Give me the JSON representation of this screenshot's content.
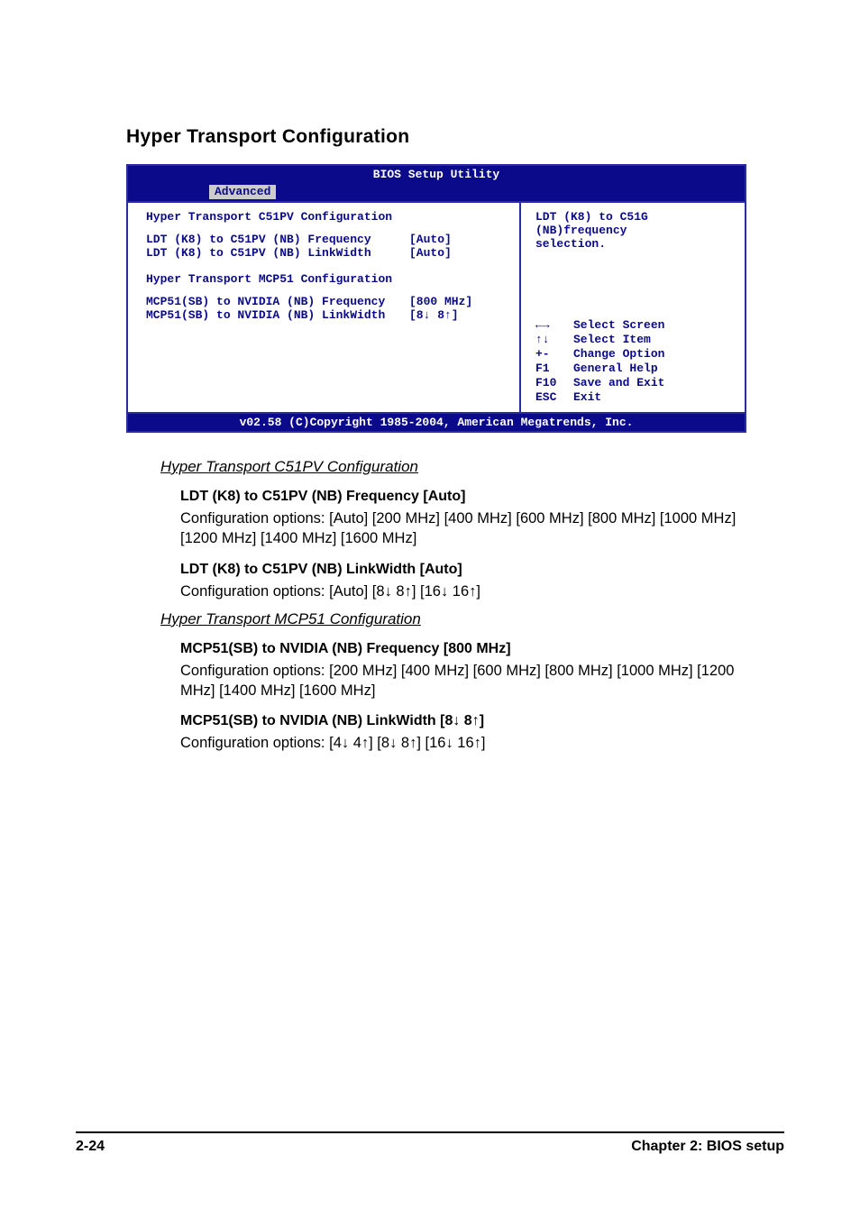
{
  "page_title": "Hyper Transport Configuration",
  "bios": {
    "utility_title": "BIOS Setup Utility",
    "tab": "Advanced",
    "left": {
      "heading1": "Hyper Transport C51PV Configuration",
      "row1_label": "LDT (K8) to C51PV (NB) Frequency",
      "row1_value": "[Auto]",
      "row2_label": "LDT (K8) to C51PV (NB) LinkWidth",
      "row2_value": "[Auto]",
      "heading2": "Hyper Transport MCP51 Configuration",
      "row3_label": "MCP51(SB) to NVIDIA (NB) Frequency",
      "row3_value": "[800 MHz]",
      "row4_label": "MCP51(SB) to NVIDIA (NB) LinkWidth",
      "row4_value": "[8↓ 8↑]"
    },
    "right": {
      "help_line1": "LDT (K8) to C51G",
      "help_line2": "(NB)frequency",
      "help_line3": "selection.",
      "nav": {
        "k1": "←→",
        "a1": "Select Screen",
        "k2": "↑↓",
        "a2": "Select Item",
        "k3": "+-",
        "a3": "Change Option",
        "k4": "F1",
        "a4": "General Help",
        "k5": "F10",
        "a5": "Save and Exit",
        "k6": "ESC",
        "a6": "Exit"
      }
    },
    "footer": "v02.58 (C)Copyright 1985-2004, American Megatrends, Inc."
  },
  "doc": {
    "sec1": "Hyper Transport C51PV Configuration",
    "i1_title": "LDT (K8) to C51PV (NB) Frequency [Auto]",
    "i1_body": "Configuration options: [Auto] [200 MHz] [400 MHz] [600 MHz] [800 MHz] [1000 MHz] [1200 MHz] [1400 MHz] [1600 MHz]",
    "i2_title": "LDT (K8) to C51PV (NB) LinkWidth [Auto]",
    "i2_pre": "Configuration options: [Auto] [8",
    "i2_mid": " 8",
    "i2_mid2": "] [16",
    "i2_mid3": " 16",
    "i2_end": "]",
    "sec2": "Hyper Transport MCP51 Configuration",
    "i3_title": "MCP51(SB) to NVIDIA (NB) Frequency [800 MHz]",
    "i3_body": "Configuration options: [200 MHz] [400 MHz] [600 MHz] [800 MHz] [1000 MHz] [1200 MHz] [1400 MHz] [1600 MHz]",
    "i4_title_pre": "MCP51(SB) to NVIDIA (NB) LinkWidth [8",
    "i4_title_mid": " 8",
    "i4_title_end": "]",
    "i4_pre": "Configuration options: [4",
    "i4_m1": " 4",
    "i4_m2": "] [8",
    "i4_m3": " 8",
    "i4_m4": "] [16",
    "i4_m5": " 16",
    "i4_end": "]"
  },
  "footer": {
    "left": "2-24",
    "right": "Chapter 2: BIOS setup"
  },
  "glyphs": {
    "down": "↓",
    "up": "↑"
  }
}
